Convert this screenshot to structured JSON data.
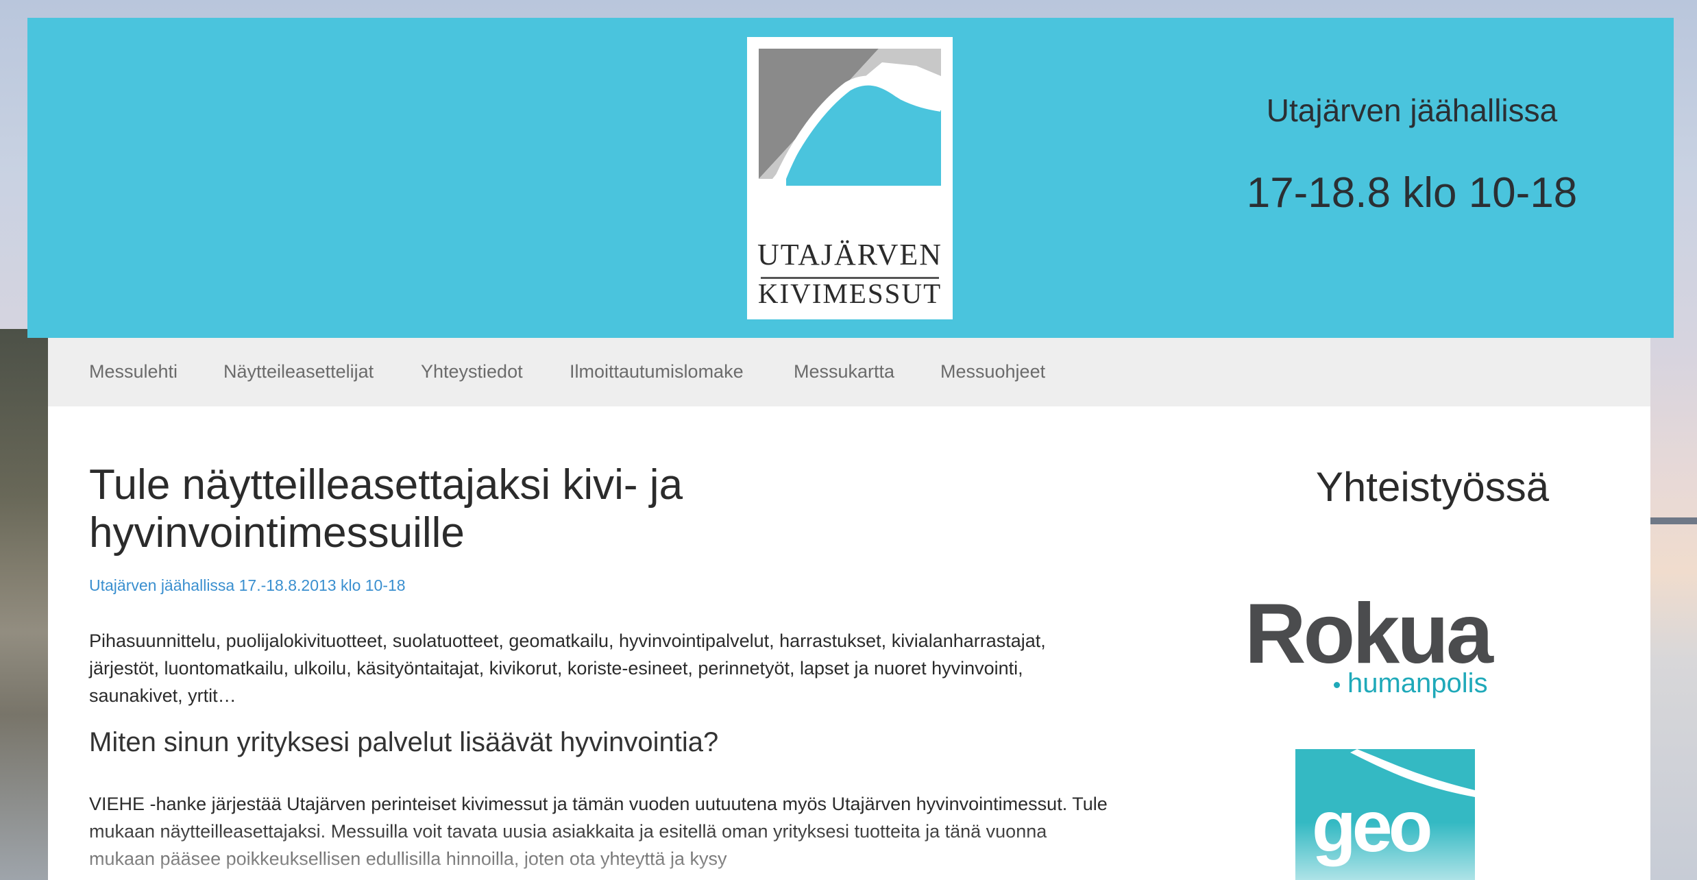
{
  "header": {
    "logo_line_1": "UTAJÄRVEN",
    "logo_line_2": "KIVIMESSUT",
    "venue": "Utajärven jäähallissa",
    "dates": "17-18.8 klo 10-18"
  },
  "nav": {
    "items": [
      {
        "label": "Messulehti"
      },
      {
        "label": "Näytteileasettelijat"
      },
      {
        "label": "Yhteystiedot"
      },
      {
        "label": "Ilmoittautumislomake"
      },
      {
        "label": "Messukartta"
      },
      {
        "label": "Messuohjeet"
      }
    ]
  },
  "main": {
    "title": "Tule näytteilleasettajaksi kivi- ja hyvinvointimessuille",
    "meta": "Utajärven jäähallissa 17.-18.8.2013 klo 10-18",
    "paragraph_1": "Pihasuunnittelu, puolijalokivituotteet, suolatuotteet, geomatkailu, hyvinvointipalvelut, harrastukset, kivialanharrastajat, järjestöt, luontomatkailu, ulkoilu, käsityöntaitajat, kivikorut, koriste-esineet, perinnetyöt, lapset ja nuoret hyvinvointi, saunakivet, yrtit…",
    "subheading": "Miten sinun yrityksesi palvelut lisäävät hyvinvointia?",
    "paragraph_2": "VIEHE -hanke järjestää Utajärven perinteiset kivimessut ja tämän vuoden uutuutena myös Utajärven hyvinvointimessut. Tule mukaan näytteilleasettajaksi. Messuilla voit tavata uusia asiakkaita ja esitellä oman yrityksesi tuotteita ja tänä vuonna mukaan pääsee poikkeuksellisen edullisilla hinnoilla, joten ota yhteyttä ja kysy"
  },
  "sidebar": {
    "title": "Yhteistyössä",
    "sponsor_1_main": "Rokua",
    "sponsor_1_sub": "humanpolis",
    "sponsor_2_main": "geo"
  },
  "colors": {
    "header_bg": "#4ac4dd",
    "nav_bg": "#eeeeee",
    "link": "#3a8fcf",
    "rokua_gray": "#4b4c4e",
    "rokua_teal": "#1fa9b9",
    "geo_teal": "#34b9c3"
  }
}
